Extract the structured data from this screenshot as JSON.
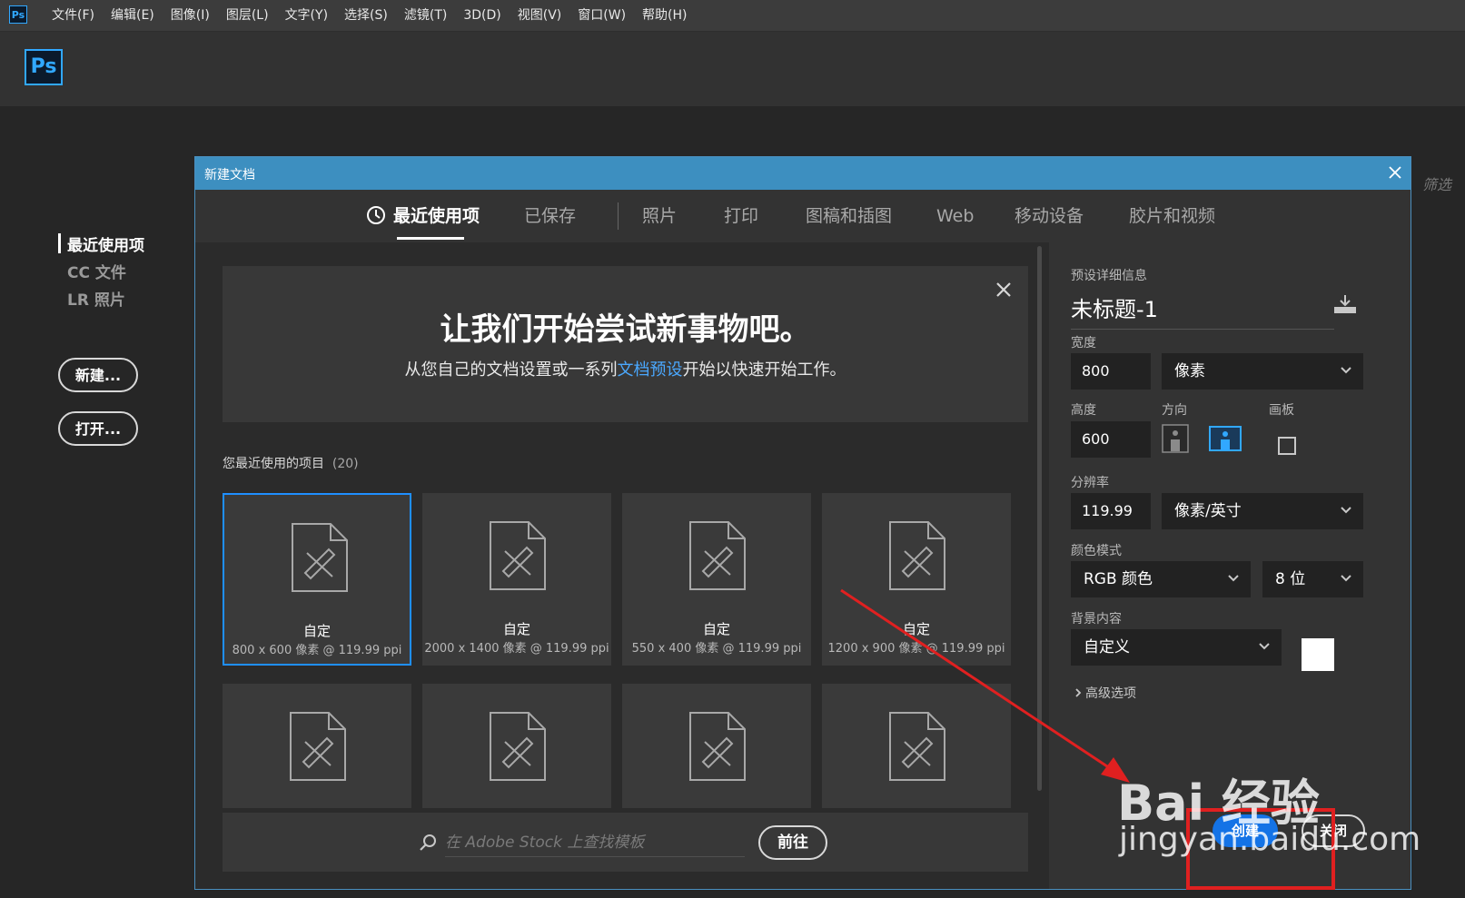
{
  "menubar": {
    "app_icon": "Ps",
    "items": [
      "文件(F)",
      "编辑(E)",
      "图像(I)",
      "图层(L)",
      "文字(Y)",
      "选择(S)",
      "滤镜(T)",
      "3D(D)",
      "视图(V)",
      "窗口(W)",
      "帮助(H)"
    ]
  },
  "header": {
    "logo": "Ps"
  },
  "home": {
    "nav": [
      "最近使用项",
      "CC 文件",
      "LR 照片"
    ],
    "new_button": "新建...",
    "open_button": "打开...",
    "filter_label": "筛选"
  },
  "dialog": {
    "title": "新建文档",
    "tabs": [
      "最近使用项",
      "已保存",
      "照片",
      "打印",
      "图稿和插图",
      "Web",
      "移动设备",
      "胶片和视频"
    ],
    "active_tab": "最近使用项",
    "welcome": {
      "title": "让我们开始尝试新事物吧。",
      "sub_before": "从您自己的文档设置或一系列",
      "sub_link": "文档预设",
      "sub_after": "开始以快速开始工作。"
    },
    "recent": {
      "label": "您最近使用的项目",
      "count": "(20)",
      "cards": [
        {
          "name": "自定",
          "info": "800 x 600 像素 @ 119.99 ppi",
          "selected": true
        },
        {
          "name": "自定",
          "info": "2000 x 1400 像素 @ 119.99 ppi"
        },
        {
          "name": "自定",
          "info": "550 x 400 像素 @ 119.99 ppi"
        },
        {
          "name": "自定",
          "info": "1200 x 900 像素 @ 119.99 ppi"
        },
        {
          "name": "",
          "info": ""
        },
        {
          "name": "",
          "info": ""
        },
        {
          "name": "",
          "info": ""
        },
        {
          "name": "",
          "info": ""
        }
      ]
    },
    "stock": {
      "placeholder": "在 Adobe Stock 上查找模板",
      "go_button": "前往"
    },
    "preset": {
      "section_label": "预设详细信息",
      "doc_name": "未标题-1",
      "width_label": "宽度",
      "width_value": "800",
      "width_unit": "像素",
      "height_label": "高度",
      "height_value": "600",
      "orientation_label": "方向",
      "artboard_label": "画板",
      "resolution_label": "分辨率",
      "resolution_value": "119.99",
      "resolution_unit": "像素/英寸",
      "color_mode_label": "颜色模式",
      "color_mode": "RGB 颜色",
      "bit_depth": "8 位",
      "background_label": "背景内容",
      "background_value": "自定义",
      "background_color": "#ffffff",
      "advanced": "高级选项",
      "create_button": "创建",
      "close_button": "关闭"
    }
  },
  "watermark": {
    "line1": "Bai 经验",
    "line2": "jingyan.baidu.com"
  },
  "colors": {
    "accent": "#31a8ff",
    "title_bar": "#3d8fc0",
    "primary_button": "#1473e6",
    "annotation": "#e02020"
  }
}
